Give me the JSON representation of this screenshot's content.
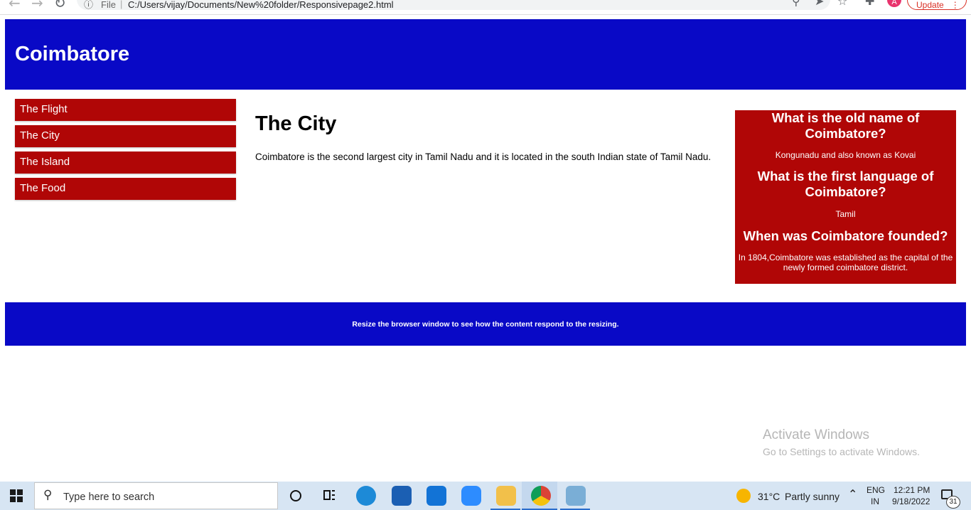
{
  "browser": {
    "url_scheme": "File",
    "url": "C:/Users/vijay/Documents/New%20folder/Responsivepage2.html",
    "avatar_letter": "A",
    "update_label": "Update"
  },
  "header": {
    "title": "Coimbatore"
  },
  "menu": {
    "items": [
      {
        "label": "The Flight"
      },
      {
        "label": "The City"
      },
      {
        "label": "The Island"
      },
      {
        "label": "The Food"
      }
    ]
  },
  "main": {
    "heading": "The City",
    "paragraph": "Coimbatore is the second largest city in Tamil Nadu and it is located in the south Indian state of Tamil Nadu."
  },
  "aside": {
    "qa": [
      {
        "question": "What is the old name of Coimbatore?",
        "answer": "Kongunadu and also known as Kovai"
      },
      {
        "question": "What is the first language of Coimbatore?",
        "answer": "Tamil"
      },
      {
        "question": "When was Coimbatore founded?",
        "answer": "In 1804,Coimbatore was established as the capital of the newly formed coimbatore district."
      }
    ]
  },
  "footer": {
    "text": "Resize the browser window to see how the content respond to the resizing."
  },
  "watermark": {
    "line1": "Activate Windows",
    "line2": "Go to Settings to activate Windows."
  },
  "taskbar": {
    "search_placeholder": "Type here to search",
    "weather_temp": "31°C",
    "weather_desc": "Partly sunny",
    "lang": "ENG",
    "region": "IN",
    "time": "12:21 PM",
    "date": "9/18/2022",
    "notification_count": "31"
  },
  "colors": {
    "header_blue": "#0909c6",
    "menu_red": "#b00606"
  }
}
